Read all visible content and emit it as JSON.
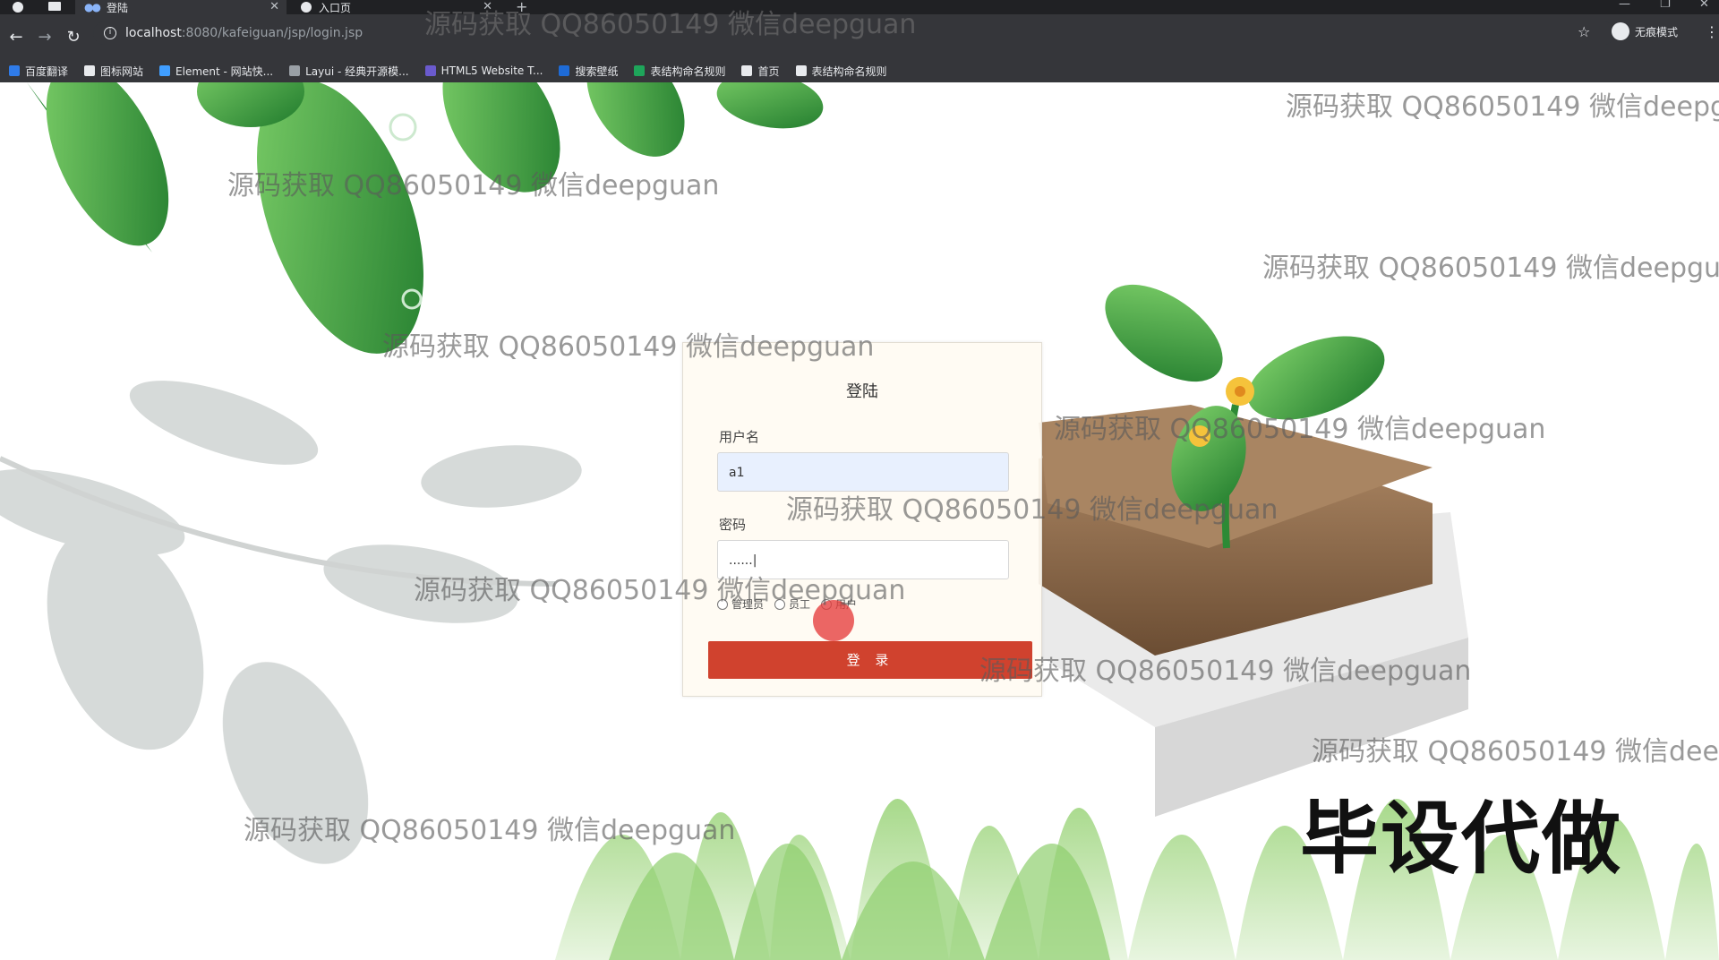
{
  "browser": {
    "tabs": [
      {
        "title": "登陆",
        "active": true
      },
      {
        "title": "入口页",
        "active": false
      }
    ],
    "url_host": "localhost",
    "url_path": ":8080/kafeiguan/jsp/login.jsp",
    "profile_label": "无痕模式",
    "bookmarks": [
      {
        "label": "百度翻译",
        "color": "#2f7be8"
      },
      {
        "label": "图标网站",
        "color": "#e8eaed"
      },
      {
        "label": "Element - 网站快...",
        "color": "#409eff"
      },
      {
        "label": "Layui - 经典开源模...",
        "color": "#9aa0a6"
      },
      {
        "label": "HTML5 Website T...",
        "color": "#6a5acd"
      },
      {
        "label": "搜索壁纸",
        "color": "#1e6bd6"
      },
      {
        "label": "表结构命名规则",
        "color": "#1ea55a"
      },
      {
        "label": "首页",
        "color": "#e8eaed"
      },
      {
        "label": "表结构命名规则",
        "color": "#e8eaed"
      }
    ]
  },
  "login": {
    "title": "登陆",
    "username_label": "用户名",
    "username_value": "a1",
    "password_label": "密码",
    "password_value": "......|",
    "roles": [
      "管理员",
      "员工",
      "用户"
    ],
    "submit_label": "登 录"
  },
  "watermarks": [
    "源码获取 QQ86050149 微信deepguan",
    "源码获取 QQ86050149 微信deepg",
    "源码获取 QQ86050149 微信deepguan",
    "源码获取 QQ86050149 微信deepgua",
    "源码获取 QQ86050149 微信deepguan",
    "源码获取 QQ86050149 微信deepguan",
    "源码获取 QQ86050149 微信deepguan",
    "源码获取 QQ86050149 微信deepguan",
    "源码获取 QQ86050149 微信deepguan",
    "源码获取 QQ86050149 微信deep",
    "源码获取 QQ86050149 微信deepguan"
  ],
  "promo_text": "毕设代做",
  "colors": {
    "login_button": "#d0422e",
    "leaf": "#2e9b3a",
    "soil": "#8a6a4a"
  }
}
